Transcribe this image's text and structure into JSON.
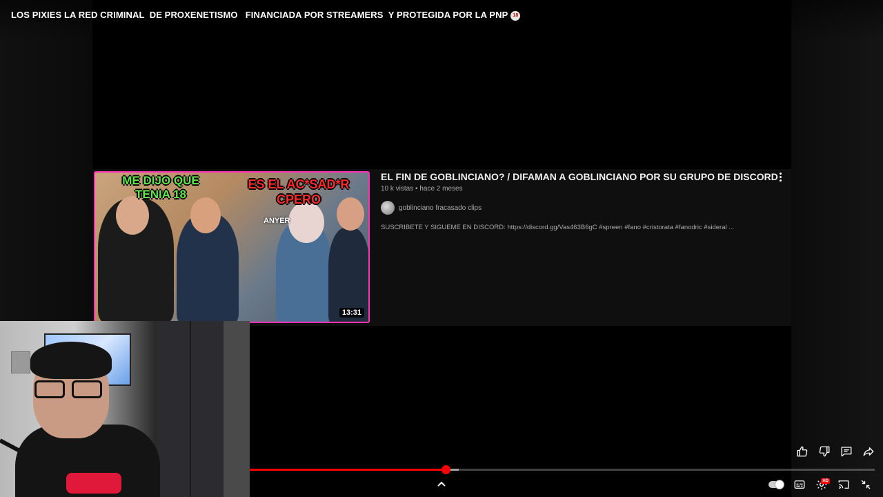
{
  "player": {
    "title": "LOS PIXIES LA RED CRIMINAL  DE PROXENETISMO   FINANCIADA POR STREAMERS  Y PROTEGIDA POR LA PNP",
    "title_badge": "18",
    "progress": {
      "played_fraction": 0.314,
      "buffered_fraction": 0.334
    }
  },
  "recommended": {
    "title": "EL FIN DE GOBLINCIANO? / DIFAMAN A GOBLINCIANO POR SU GRUPO DE DISCORD",
    "views": "10 k vistas",
    "separator": "•",
    "age": "hace 2 meses",
    "channel": "goblinciano fracasado clips",
    "description": "SUSCRIBETE Y SIGUEME EN DISCORD: https://discord.gg/Vas463B6gC #spreen #fano #cristorata #fanodric #sideral ...",
    "duration": "13:31",
    "thumbnail_text": {
      "left": "ME DIJO QUE TENIA 18",
      "right": "ES EL AC*SAD*R CPERO",
      "tag": "ANYER"
    },
    "border_color": "#ff2fb6"
  },
  "actions": {
    "like_icon": "thumbs-up-icon",
    "dislike_icon": "thumbs-down-icon",
    "comments_icon": "comment-icon",
    "share_icon": "share-icon"
  },
  "controls": {
    "autoplay": true,
    "hd_label": "HD",
    "icons": [
      "autoplay-toggle",
      "subtitles-icon",
      "settings-icon",
      "cast-icon",
      "exit-fullscreen-icon"
    ]
  },
  "colors": {
    "accent": "#ff0000",
    "background": "#000000"
  }
}
